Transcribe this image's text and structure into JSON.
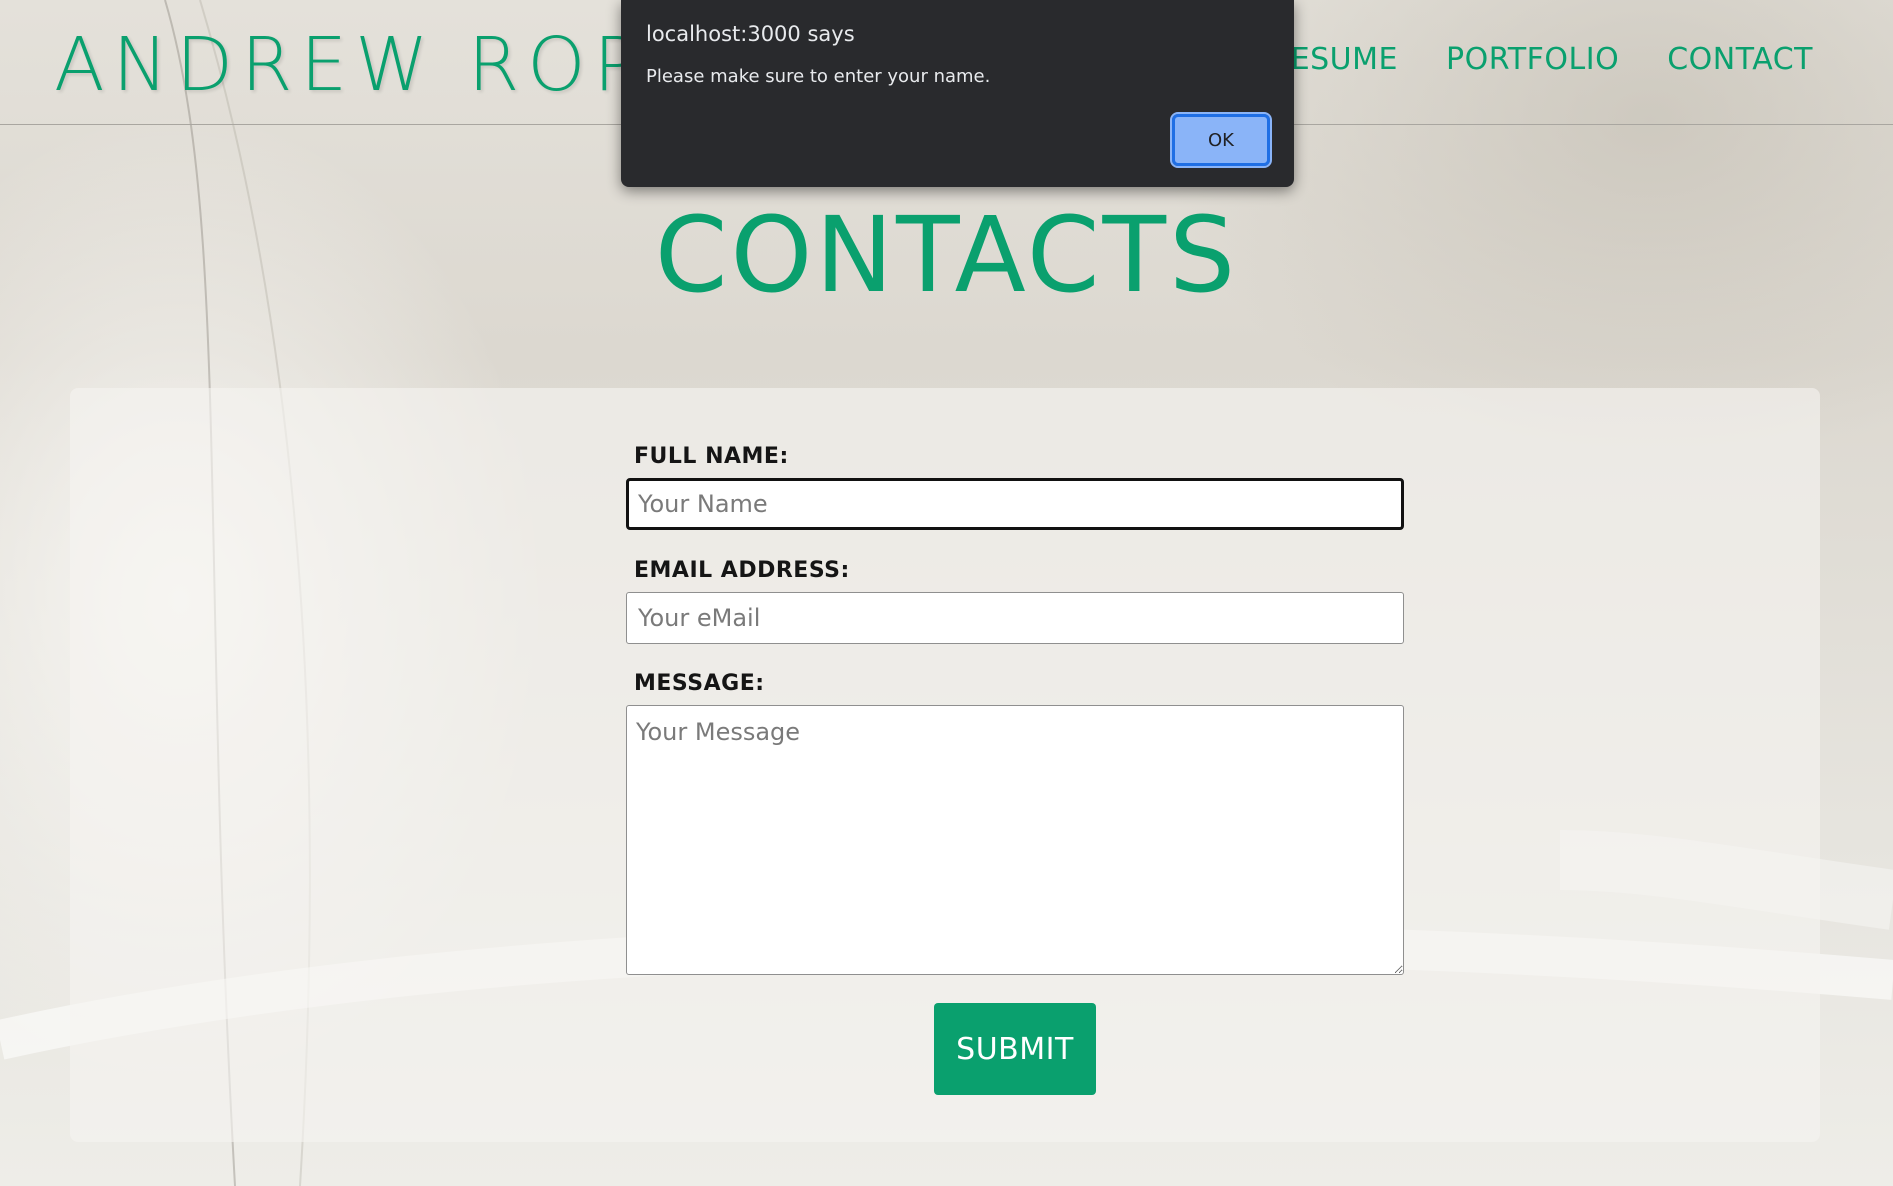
{
  "header": {
    "logo": "ANDREW ROPER",
    "nav": [
      "RESUME",
      "PORTFOLIO",
      "CONTACT"
    ]
  },
  "page": {
    "title": "CONTACTS"
  },
  "form": {
    "name_label": "FULL NAME:",
    "name_placeholder": "Your Name",
    "email_label": "EMAIL ADDRESS:",
    "email_placeholder": "Your eMail",
    "message_label": "MESSAGE:",
    "message_placeholder": "Your Message",
    "submit_label": "SUBMIT"
  },
  "alert": {
    "title": "localhost:3000 says",
    "message": "Please make sure to enter your name.",
    "ok_label": "OK"
  },
  "colors": {
    "accent": "#0aa06e",
    "dialog_bg": "#292a2d",
    "dialog_button": "#8ab4f8"
  }
}
